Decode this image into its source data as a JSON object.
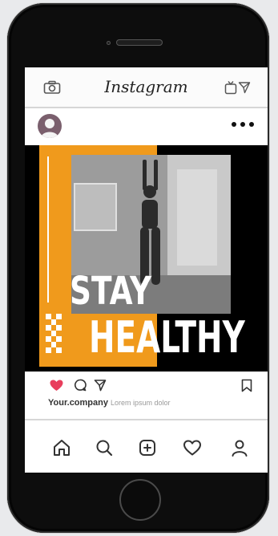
{
  "app": {
    "logo_text": "Instagram",
    "brand_accent": "#f09a1c",
    "like_color": "#e83e5c"
  },
  "header": {
    "icons": [
      "camera-icon",
      "igtv-icon",
      "direct-message-icon"
    ]
  },
  "post": {
    "headline_line1": "STAY",
    "headline_line2": "HEALTHY",
    "username": "Your.company",
    "caption": "Lorem ipsum dolor",
    "liked": true
  },
  "bottom_nav": {
    "items": [
      "home-icon",
      "search-icon",
      "add-post-icon",
      "activity-icon",
      "profile-icon"
    ]
  }
}
